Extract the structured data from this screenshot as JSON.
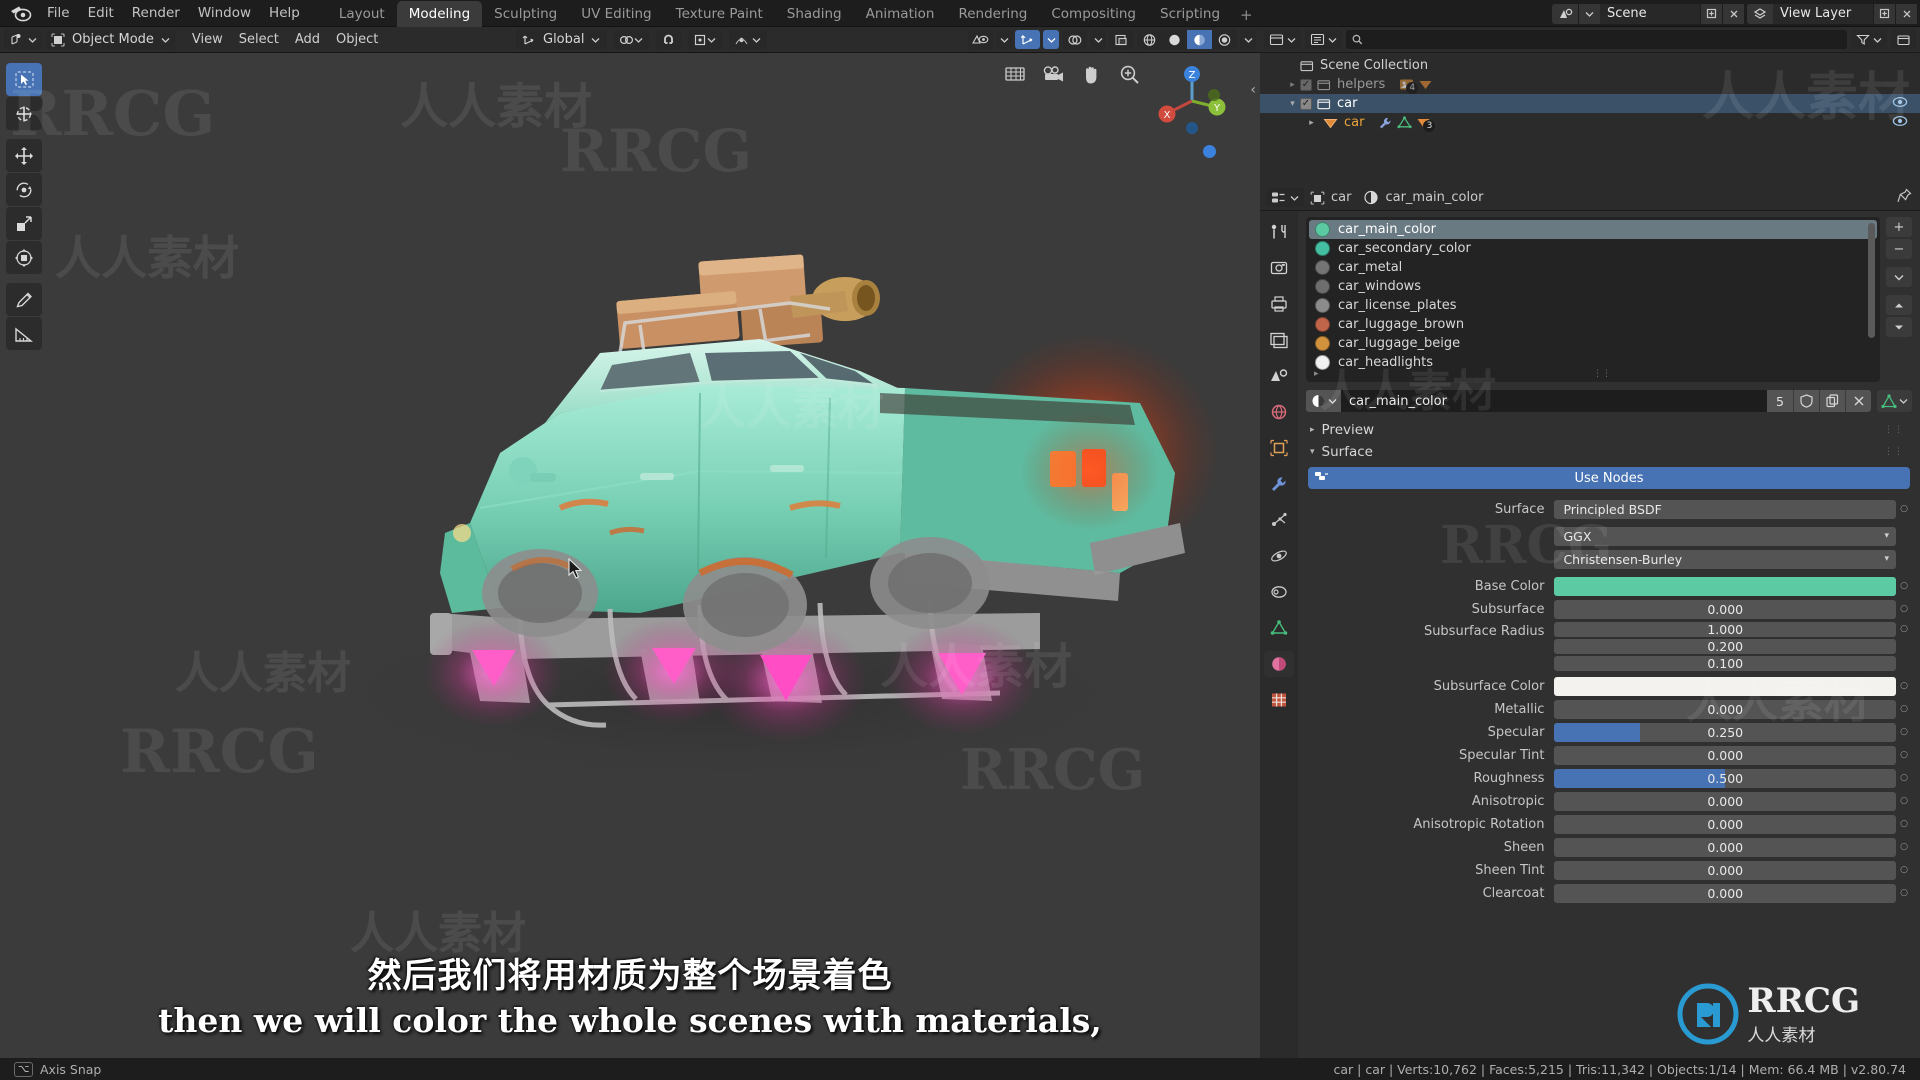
{
  "app": {
    "name": "Blender",
    "version": "v2.80.74"
  },
  "topbar": {
    "menus": [
      "File",
      "Edit",
      "Render",
      "Window",
      "Help"
    ],
    "workspace_tabs": [
      {
        "label": "Layout",
        "active": false
      },
      {
        "label": "Modeling",
        "active": true
      },
      {
        "label": "Sculpting",
        "active": false
      },
      {
        "label": "UV Editing",
        "active": false
      },
      {
        "label": "Texture Paint",
        "active": false
      },
      {
        "label": "Shading",
        "active": false
      },
      {
        "label": "Animation",
        "active": false
      },
      {
        "label": "Rendering",
        "active": false
      },
      {
        "label": "Compositing",
        "active": false
      },
      {
        "label": "Scripting",
        "active": false
      }
    ],
    "add_workspace_label": "+",
    "scene_name": "Scene",
    "view_layer_name": "View Layer"
  },
  "viewport": {
    "mode": "Object Mode",
    "menus": [
      "View",
      "Select",
      "Add",
      "Object"
    ],
    "transform_orientation": "Global",
    "overlay_icons": [
      "visibility-icon",
      "snap-magnet-icon",
      "proportional-edit-icon",
      "xray-icon",
      "shading-wireframe-icon",
      "shading-solid-icon",
      "shading-material-icon",
      "shading-rendered-icon"
    ],
    "tools": [
      {
        "name": "tweak-tool",
        "active": true
      },
      {
        "name": "cursor-tool",
        "active": false
      },
      {
        "name": "move-tool",
        "active": false
      },
      {
        "name": "rotate-tool",
        "active": false
      },
      {
        "name": "scale-tool",
        "active": false
      },
      {
        "name": "transform-tool",
        "active": false
      },
      {
        "name": "annotate-tool",
        "active": false
      },
      {
        "name": "measure-tool",
        "active": false
      }
    ],
    "nav_icons": [
      "zoom-region-icon",
      "camera-view-icon",
      "move-view-icon",
      "zoom-view-icon"
    ],
    "gizmo_axes": [
      "X",
      "Y",
      "Z"
    ]
  },
  "subtitles": {
    "chinese": "然后我们将用材质为整个场景着色",
    "english": "then we will color the whole scenes with materials,"
  },
  "outliner": {
    "search_placeholder": "",
    "items": [
      {
        "label": "Scene Collection",
        "indent": 0,
        "type": "collection",
        "selected": false,
        "checkbox": false,
        "expandable": false
      },
      {
        "label": "helpers",
        "indent": 1,
        "type": "collection",
        "selected": false,
        "checkbox": true,
        "expandable": true,
        "expanded": false,
        "badge": "4",
        "dimmed": true
      },
      {
        "label": "car",
        "indent": 1,
        "type": "collection",
        "selected": true,
        "checkbox": true,
        "expandable": true,
        "expanded": true
      },
      {
        "label": "car",
        "indent": 2,
        "type": "object",
        "selected": false,
        "checkbox": false,
        "expandable": true,
        "expanded": false,
        "badge": "3",
        "orange": true
      }
    ]
  },
  "properties": {
    "breadcrumb": [
      "car",
      "car_main_color"
    ],
    "tabs": [
      {
        "name": "tool-tab",
        "active": false
      },
      {
        "name": "render-tab",
        "active": false
      },
      {
        "name": "output-tab",
        "active": false
      },
      {
        "name": "view-layer-tab",
        "active": false
      },
      {
        "name": "scene-tab",
        "active": false
      },
      {
        "name": "world-tab",
        "active": false
      },
      {
        "name": "object-tab",
        "active": false
      },
      {
        "name": "modifier-tab",
        "active": false
      },
      {
        "name": "particles-tab",
        "active": false
      },
      {
        "name": "physics-tab",
        "active": false
      },
      {
        "name": "constraints-tab",
        "active": false
      },
      {
        "name": "object-data-tab",
        "active": false
      },
      {
        "name": "material-tab",
        "active": true
      },
      {
        "name": "texture-tab",
        "active": false
      }
    ],
    "material_slots": [
      {
        "label": "car_main_color",
        "color": "#5bc9a1",
        "selected": true
      },
      {
        "label": "car_secondary_color",
        "color": "#44bfa1",
        "selected": false
      },
      {
        "label": "car_metal",
        "color": "#747474",
        "selected": false
      },
      {
        "label": "car_windows",
        "color": "#6e6e6e",
        "selected": false
      },
      {
        "label": "car_license_plates",
        "color": "#8b8b8b",
        "selected": false
      },
      {
        "label": "car_luggage_brown",
        "color": "#c0644a",
        "selected": false
      },
      {
        "label": "car_luggage_beige",
        "color": "#d1923e",
        "selected": false
      },
      {
        "label": "car_headlights",
        "color": "#f2f2f2",
        "selected": false
      }
    ],
    "slot_buttons": [
      "add-material-slot",
      "remove-material-slot",
      "slot-specials-menu",
      "move-slot-up",
      "move-slot-down"
    ],
    "material_name": "car_main_color",
    "material_users": "5",
    "material_buttons": [
      "fake-user-icon",
      "new-material-icon",
      "unlink-material-icon"
    ],
    "panels": [
      {
        "label": "Preview",
        "expanded": false
      },
      {
        "label": "Surface",
        "expanded": true
      }
    ],
    "use_nodes_label": "Use Nodes",
    "surface_fields": [
      {
        "label": "Surface",
        "type": "enum_plain",
        "value": "Principled BSDF",
        "has_dot": true
      },
      {
        "label": "",
        "type": "enum",
        "value": "GGX",
        "has_dot": false
      },
      {
        "label": "",
        "type": "enum",
        "value": "Christensen-Burley",
        "has_dot": false
      },
      {
        "label": "Base Color",
        "type": "color",
        "value": "#5ccaa2",
        "has_dot": true
      },
      {
        "label": "Subsurface",
        "type": "slider",
        "value": "0.000",
        "fill": 0,
        "has_dot": true
      },
      {
        "label": "Subsurface Radius",
        "type": "vector",
        "values": [
          "1.000",
          "0.200",
          "0.100"
        ],
        "has_dot": true
      },
      {
        "label": "Subsurface Color",
        "type": "color",
        "value": "#f4f2ee",
        "has_dot": true
      },
      {
        "label": "Metallic",
        "type": "slider",
        "value": "0.000",
        "fill": 0,
        "has_dot": true
      },
      {
        "label": "Specular",
        "type": "slider",
        "value": "0.250",
        "fill": 25,
        "has_dot": true
      },
      {
        "label": "Specular Tint",
        "type": "slider",
        "value": "0.000",
        "fill": 0,
        "has_dot": true
      },
      {
        "label": "Roughness",
        "type": "slider",
        "value": "0.500",
        "fill": 50,
        "has_dot": true
      },
      {
        "label": "Anisotropic",
        "type": "slider",
        "value": "0.000",
        "fill": 0,
        "has_dot": true
      },
      {
        "label": "Anisotropic Rotation",
        "type": "slider",
        "value": "0.000",
        "fill": 0,
        "has_dot": true
      },
      {
        "label": "Sheen",
        "type": "slider",
        "value": "0.000",
        "fill": 0,
        "has_dot": true
      },
      {
        "label": "Sheen Tint",
        "type": "slider",
        "value": "0.000",
        "fill": 0,
        "has_dot": true
      },
      {
        "label": "Clearcoat",
        "type": "slider",
        "value": "0.000",
        "fill": 0,
        "has_dot": true
      }
    ]
  },
  "statusbar": {
    "keymap_key": "⌥",
    "keymap_label": "Axis Snap",
    "stats": "car | car | Verts:10,762 | Faces:5,215 | Tris:11,342 | Objects:1/14 | Mem: 66.4 MB | v2.80.74"
  },
  "watermarks": {
    "latin": "RRCG",
    "chinese": "人人素材",
    "logo_text": "RRCG",
    "logo_sub": "人人素材"
  },
  "colors": {
    "accent_blue": "#4772b3",
    "selection_orange": "#e8a33d",
    "panel_bg": "#303030",
    "viewport_bg": "#3b3b3b",
    "car_body": "#7fd8bf"
  }
}
